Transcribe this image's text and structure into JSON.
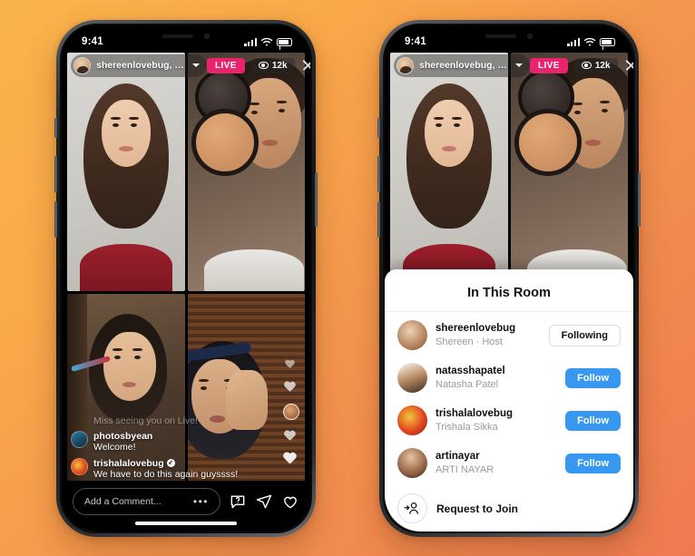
{
  "background": {
    "gradient_from": "#f9b44c",
    "gradient_to": "#ef7a50"
  },
  "colors": {
    "live_badge": "#e8246e",
    "follow_blue": "#3897f0",
    "sheet_bg": "#ffffff"
  },
  "phones": [
    {
      "id": "phone-left",
      "status_bar": {
        "time": "9:41",
        "signal": "signal-bars-icon",
        "wifi": "wifi-icon",
        "battery": "battery-icon"
      },
      "live_header": {
        "host_handle": "shereenlovebug, n...",
        "chevron": "chevron-down-icon",
        "live_label": "LIVE",
        "viewer_count": "12k",
        "viewer_icon": "eye-icon",
        "close_icon": "close-icon"
      },
      "comments": [
        {
          "user": "",
          "text": "Miss seeing you on Live!",
          "faded": true,
          "verified": false
        },
        {
          "user": "photosbyean",
          "text": "Welcome!",
          "faded": false,
          "verified": false
        },
        {
          "user": "trishalalovebug",
          "text": "We have to do this again guyssss!",
          "faded": false,
          "verified": true
        }
      ],
      "bottom_bar": {
        "comment_placeholder": "Add a Comment...",
        "more_icon": "ellipsis-icon",
        "question_icon": "question-chat-icon",
        "share_icon": "paper-plane-icon",
        "like_icon": "heart-icon"
      }
    },
    {
      "id": "phone-right",
      "status_bar": {
        "time": "9:41",
        "signal": "signal-bars-icon",
        "wifi": "wifi-icon",
        "battery": "battery-icon"
      },
      "live_header": {
        "host_handle": "shereenlovebug, n...",
        "chevron": "chevron-down-icon",
        "live_label": "LIVE",
        "viewer_count": "12k",
        "viewer_icon": "eye-icon",
        "close_icon": "close-icon"
      },
      "room_sheet": {
        "grabber": "drag-handle",
        "title": "In This Room",
        "members": [
          {
            "username": "shereenlovebug",
            "subtitle": "Shereen · Host",
            "action": "Following",
            "action_style": "following"
          },
          {
            "username": "natasshapatel",
            "subtitle": "Natasha Patel",
            "action": "Follow",
            "action_style": "follow"
          },
          {
            "username": "trishalalovebug",
            "subtitle": "Trishala Sikka",
            "action": "Follow",
            "action_style": "follow"
          },
          {
            "username": "artinayar",
            "subtitle": "ARTI NAYAR",
            "action": "Follow",
            "action_style": "follow"
          }
        ],
        "request_row": {
          "icon": "person-add-icon",
          "label": "Request to Join"
        }
      }
    }
  ]
}
